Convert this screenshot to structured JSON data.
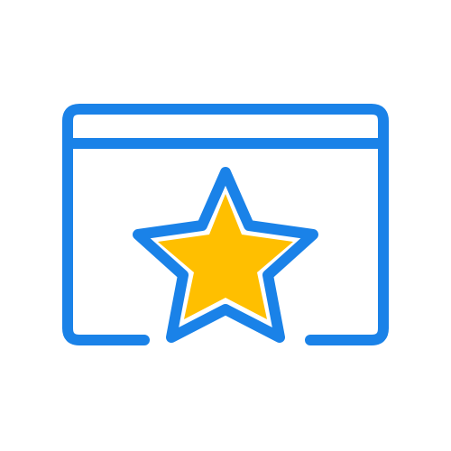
{
  "icon": {
    "name": "browser-window-star-icon",
    "window_icon": "browser-window-icon",
    "star_icon": "star-icon"
  },
  "colors": {
    "background": "#ffffff",
    "window_stroke": "#1a82e8",
    "star_outline": "#1a82e8",
    "star_fill": "#ffbf00"
  }
}
